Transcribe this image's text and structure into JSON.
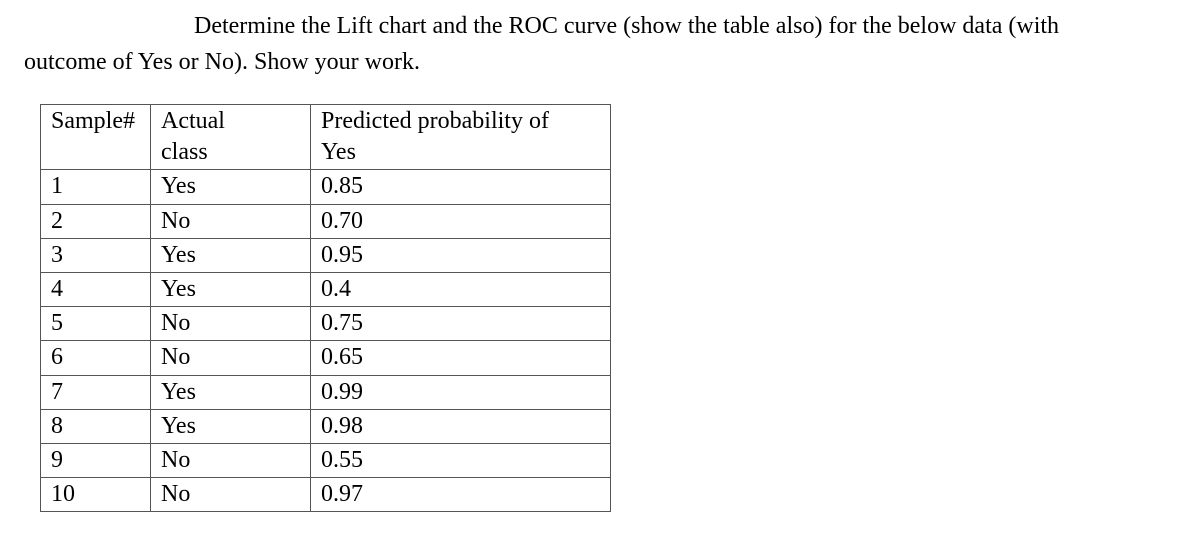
{
  "prompt": {
    "line1": "Determine the Lift chart and the ROC curve (show the table also) for the below data (with",
    "line2": "outcome of Yes or No). Show your work."
  },
  "table": {
    "headers": {
      "col1": "Sample#",
      "col2a": "Actual",
      "col2b": "class",
      "col3a": "Predicted probability of",
      "col3b": "Yes"
    },
    "rows": [
      {
        "sample": "1",
        "actual": "Yes",
        "prob": "0.85"
      },
      {
        "sample": "2",
        "actual": "No",
        "prob": "0.70"
      },
      {
        "sample": "3",
        "actual": "Yes",
        "prob": "0.95"
      },
      {
        "sample": "4",
        "actual": "Yes",
        "prob": "0.4"
      },
      {
        "sample": "5",
        "actual": "No",
        "prob": "0.75"
      },
      {
        "sample": "6",
        "actual": "No",
        "prob": "0.65"
      },
      {
        "sample": "7",
        "actual": "Yes",
        "prob": "0.99"
      },
      {
        "sample": "8",
        "actual": "Yes",
        "prob": "0.98"
      },
      {
        "sample": "9",
        "actual": "No",
        "prob": "0.55"
      },
      {
        "sample": "10",
        "actual": "No",
        "prob": "0.97"
      }
    ]
  }
}
